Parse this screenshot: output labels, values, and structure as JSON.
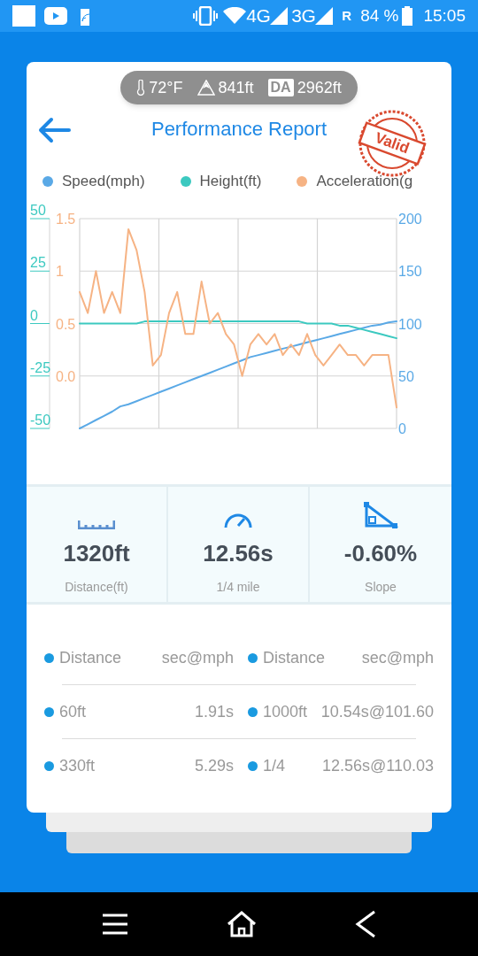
{
  "status_bar": {
    "network_1": "4G",
    "network_2": "3G",
    "roaming": "R",
    "battery": "84 %",
    "time": "15:05"
  },
  "conditions": {
    "temperature": "72°F",
    "elevation": "841ft",
    "density_label": "DA",
    "density_altitude": "2962ft"
  },
  "header": {
    "title": "Performance Report",
    "stamp": "Valid"
  },
  "chart": {
    "chart_data": {
      "type": "line",
      "grid": true,
      "ylim": [
        -50,
        50
      ],
      "yticks": [
        {
          "value": 50,
          "label": "50"
        },
        {
          "value": 25,
          "label": "25"
        },
        {
          "value": 0,
          "label": "0"
        },
        {
          "value": -25,
          "label": "-25"
        },
        {
          "value": -50,
          "label": "-50"
        }
      ],
      "y2lim": [
        0,
        200
      ],
      "y2ticks": [
        {
          "value": 200,
          "label": "200"
        },
        {
          "value": 150,
          "label": "150"
        },
        {
          "value": 100,
          "label": "100"
        },
        {
          "value": 50,
          "label": "50"
        },
        {
          "value": 0,
          "label": "0"
        }
      ],
      "y3lim": [
        -0.5,
        1.5
      ],
      "y3ticks": [
        {
          "value": 1.5,
          "label": "1.5"
        },
        {
          "value": 1,
          "label": "1"
        },
        {
          "value": 0.5,
          "label": "0.5"
        },
        {
          "value": 0,
          "label": "0.0"
        }
      ],
      "series": [
        {
          "name": "Speed(mph)",
          "color": "#5aa9e6",
          "axis": "y2",
          "values": [
            0,
            4,
            8,
            12,
            16,
            21,
            23,
            26,
            29,
            32,
            35,
            38,
            41,
            44,
            47,
            50,
            53,
            56,
            59,
            62,
            65,
            68,
            70,
            72,
            74,
            76,
            78,
            80,
            82,
            84,
            86,
            88,
            90,
            92,
            94,
            96,
            98,
            99,
            101,
            102
          ]
        },
        {
          "name": "Height(ft)",
          "color": "#3cc9c0",
          "values": [
            0,
            0,
            0,
            0,
            0,
            0,
            0,
            0,
            1,
            1,
            1,
            1,
            1,
            1,
            1,
            1,
            1,
            1,
            1,
            1,
            1,
            1,
            1,
            1,
            1,
            1,
            1,
            1,
            0,
            0,
            0,
            0,
            -1,
            -1,
            -2,
            -3,
            -4,
            -5,
            -6,
            -7
          ]
        },
        {
          "name": "Acceleration(g",
          "color": "#f6b384",
          "axis": "y3",
          "values": [
            0.8,
            0.6,
            1.0,
            0.6,
            0.8,
            0.6,
            1.4,
            1.2,
            0.8,
            0.1,
            0.2,
            0.6,
            0.8,
            0.4,
            0.4,
            0.9,
            0.5,
            0.6,
            0.4,
            0.3,
            0.0,
            0.3,
            0.4,
            0.3,
            0.4,
            0.2,
            0.3,
            0.2,
            0.4,
            0.2,
            0.1,
            0.2,
            0.3,
            0.2,
            0.2,
            0.1,
            0.2,
            0.2,
            0.2,
            -0.3
          ]
        }
      ]
    }
  },
  "stats": [
    {
      "kind": "ruler",
      "value": "1320ft",
      "label": "Distance(ft)"
    },
    {
      "kind": "gauge",
      "value": "12.56s",
      "label": "1/4 mile"
    },
    {
      "kind": "slope",
      "value": "-0.60%",
      "label": "Slope"
    }
  ],
  "splits": [
    {
      "left": {
        "name": "Distance",
        "value": "sec@mph"
      },
      "right": {
        "name": "Distance",
        "value": "sec@mph"
      }
    },
    {
      "left": {
        "name": "60ft",
        "value": "1.91s"
      },
      "right": {
        "name": "1000ft",
        "value": "10.54s@101.60"
      }
    },
    {
      "left": {
        "name": "330ft",
        "value": "5.29s"
      },
      "right": {
        "name": "1/4",
        "value": "12.56s@110.03"
      }
    }
  ]
}
